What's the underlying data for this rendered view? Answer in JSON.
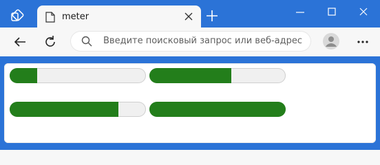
{
  "browser": {
    "tab": {
      "title": "meter"
    },
    "address_bar": {
      "placeholder": "Введите поисковый запрос или веб-адрес"
    },
    "icons": {
      "workspaces": "workspaces-icon",
      "page": "page-icon",
      "close": "close-icon",
      "new_tab": "plus-icon",
      "minimize": "minimize-icon",
      "maximize": "maximize-icon",
      "window_close": "close-icon",
      "back": "back-arrow-icon",
      "refresh": "refresh-icon",
      "search": "search-icon",
      "profile": "profile-icon",
      "more": "more-icon"
    }
  },
  "meters": [
    {
      "value": 0.2
    },
    {
      "value": 0.6
    },
    {
      "value": 0.8
    },
    {
      "value": 1.0
    }
  ],
  "colors": {
    "titlebar": "#2b73d7",
    "meter_fill": "#237e1b",
    "meter_track": "#f0f0f0"
  }
}
